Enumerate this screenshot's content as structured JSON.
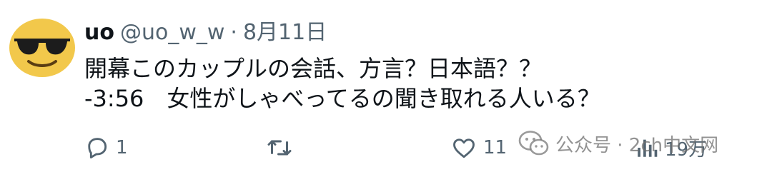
{
  "tweet": {
    "display_name": "uo",
    "handle": "@uo_w_w",
    "separator": "·",
    "date": "8月11日",
    "line1": "開幕このカップルの会話、方言？日本語？？",
    "line2": "-3:56　女性がしゃべってるの聞き取れる人いる？"
  },
  "actions": {
    "reply_count": "1",
    "retweet_count": "",
    "like_count": "11",
    "views_count": "19万"
  },
  "watermark": {
    "text": "公众号 · 2ch中文网"
  },
  "colors": {
    "text": "#0f1419",
    "muted": "#536471",
    "avatar_face": "#f2c84b"
  },
  "icons": {
    "avatar": "sunglasses-emoji-avatar",
    "reply": "reply-icon",
    "retweet": "retweet-icon",
    "like": "heart-icon",
    "views": "views-bar-icon",
    "watermark": "wechat-icon"
  }
}
